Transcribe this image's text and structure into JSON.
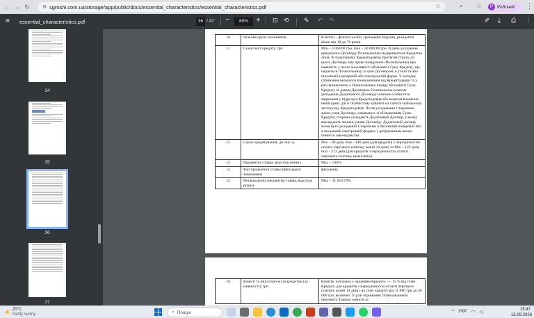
{
  "browser": {
    "url": "sgroshi.com.ua/storage/app/public/docs/essential_characteristics/essential_characteristics.pdf",
    "profile_name": "Робочий",
    "profile_initial": "Р"
  },
  "viewer": {
    "file_name": "essential_characteristics.pdf",
    "current_page": "36",
    "total_pages": "/ 47",
    "zoom": "80%"
  },
  "thumbnails": [
    {
      "label": "34"
    },
    {
      "label": "35"
    },
    {
      "label": "36",
      "selected": true
    },
    {
      "label": "37"
    }
  ],
  "page1": {
    "rows": [
      {
        "num": "10",
        "label": "Цільова група споживачів",
        "value": "Клієнти – фізичні особи, громадяни України, резиденти віком від 18 до 70 років"
      },
      {
        "num": "11",
        "label": "Сума/ліміт кредиту, грн",
        "value": "Min – 3 000,00 грн, max – 50 000,00 грн. В день укладення кредитного Договору Позичальнику відкривається Кредитна лінія. В подальшому Кредитодавець протягом строку дії цього Договору має право повідомити Позичальника про наявність у нього можливості збільшити Суму Кредиту, що надається Позичальнику за цим Договором, в усній та/або письмовій (паперовій або електронній) формі. У випадку отримання вказаного повідомлення від Кредитодавця та у разі виникнення у Позичальника наміру збільшити Суму Кредиту за даним Договором Позичальник шляхом укладення Додаткового Договору шляхом особистого звернення у підрозділ Кредитодавця або шляхом вчинення необхідних дій в Особистому кабінеті на сайті/в мобільному застосунку Кредитодавця. Після узгодження Сторонами зміни умов Договору, пов'язаних зі збільшенням Суми Кредиту, сторони укладають Додатковий Договір, у якому викладають змінені умови Договору. Додатковий договір може бути укладений Сторонами в письмовій паперовій або в письмовій електронній формах з дотриманням вимог чинного законодавства."
      },
      {
        "num": "12",
        "label": "Строк кредитування, дн./міс./р.",
        "value": "Min – 98 днів, max - 140 днів (для кредитів з періодичністю оплати чергового платежу кожні 14 днів) та Min – 122 днів, max - 213 днів (для кредитів з періодичністю оплати чергового платежу щомісячно)"
      },
      {
        "num": "13",
        "label": "Процентна ставка, відсотки річних",
        "value": "Max – 336%"
      },
      {
        "num": "14",
        "label": "Тип процентної ставки (фіксована/змінювана)",
        "value": "фіксована"
      },
      {
        "num": "15",
        "label": "Реальна річна процентна ставка, відсотки річних",
        "value": "Max – 11 016,79%"
      }
    ]
  },
  "page2": {
    "rows": [
      {
        "num": "16",
        "label": "Комісії та інші платежі за кредитом (за наявності), грн",
        "value": "Комісія, пов'язана з наданням Кредиту: — 15 % від суми Кредиту для кредитів з періодичністю оплати чергового платежу кожні 14 днів і на суму кредиту від 11 000 грн до 50 000 грн. включно. У разі отримання Позичальником чергового Траншу комісія за"
      }
    ]
  },
  "taskbar": {
    "temperature": "20°C",
    "weather": "Partly sunny",
    "search_placeholder": "Пошук",
    "language": "УКР",
    "time": "15:47",
    "date": "15.09.2026"
  }
}
